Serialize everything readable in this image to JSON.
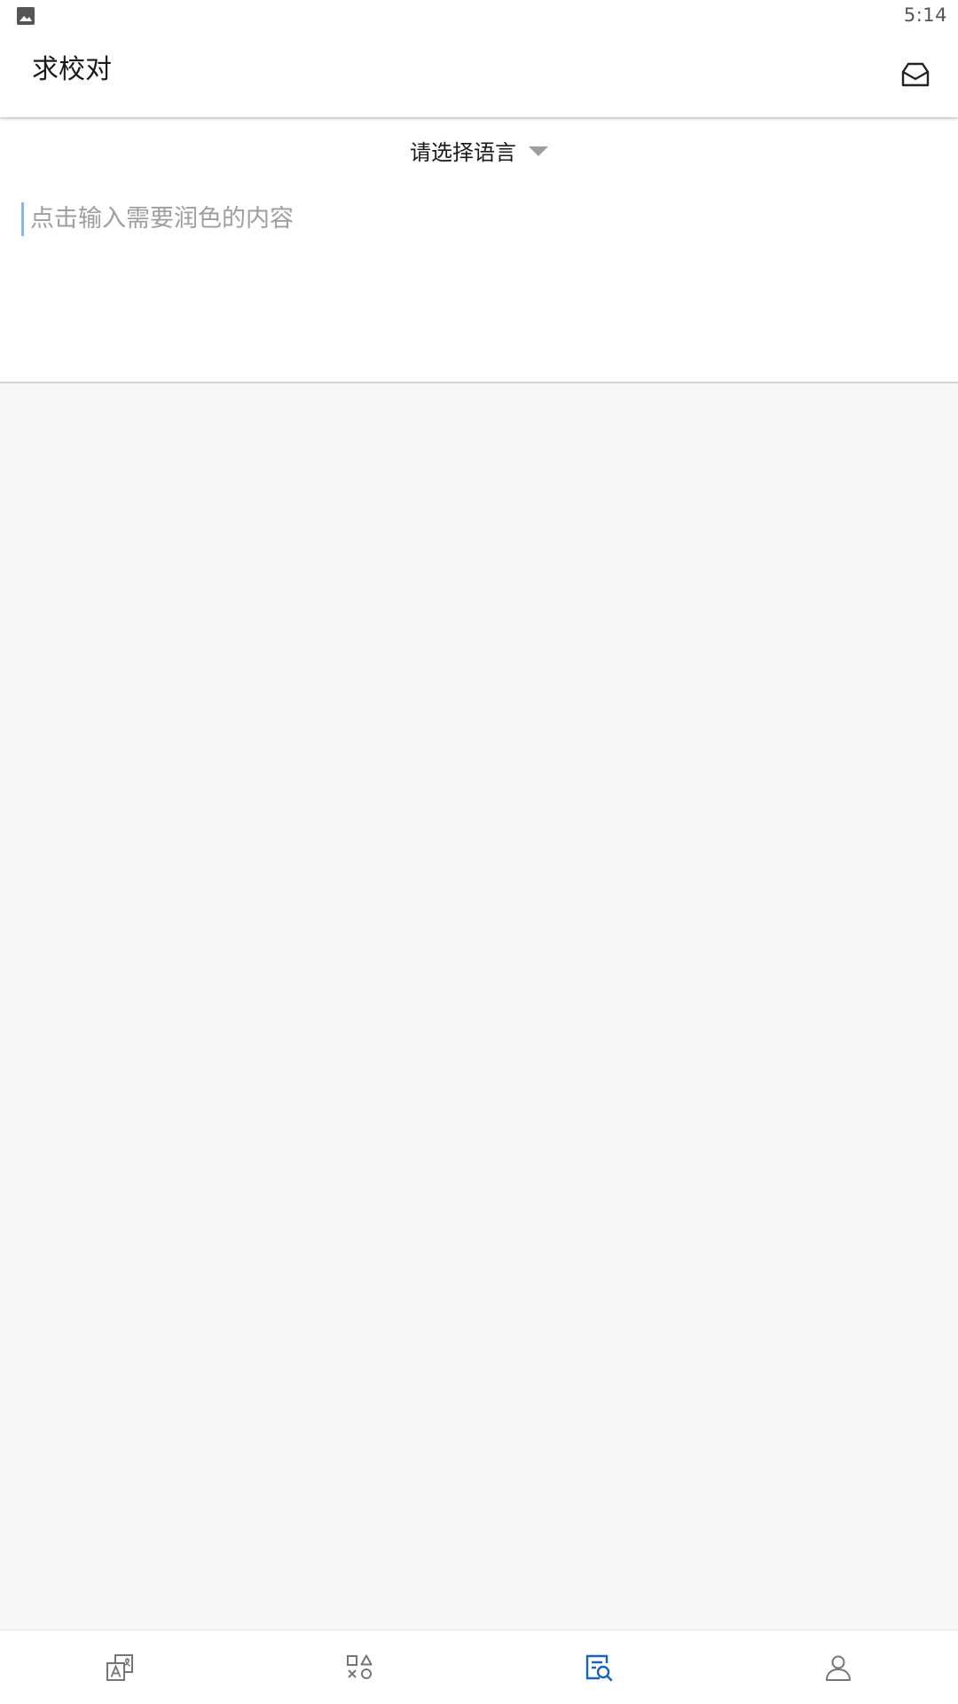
{
  "status_bar": {
    "time": "5:14",
    "left_icon": "image-icon"
  },
  "app_bar": {
    "title": "求校对",
    "action_icon": "inbox-icon"
  },
  "editor": {
    "language_selector": "请选择语言",
    "dropdown_icon": "dropdown-arrow-icon",
    "placeholder": "点击输入需要润色的内容",
    "value": ""
  },
  "bottom_nav": {
    "items": [
      {
        "icon": "translate-icon",
        "selected": false
      },
      {
        "icon": "apps-icon",
        "selected": false
      },
      {
        "icon": "proofread-search-icon",
        "selected": true
      },
      {
        "icon": "profile-icon",
        "selected": false
      }
    ]
  },
  "colors": {
    "accent": "#1565c0",
    "icon_inactive": "#757575",
    "background": "#f6f6f6",
    "caret": "#8fb6e0"
  }
}
